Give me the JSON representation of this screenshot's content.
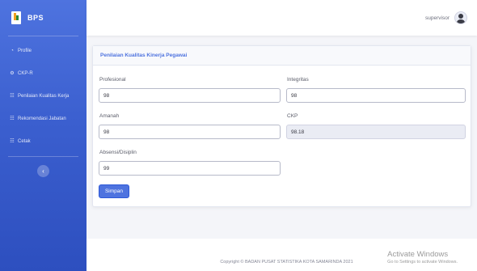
{
  "brand": {
    "name": "BPS",
    "logo_icon": "bps-logo-icon"
  },
  "sidebar": {
    "items": [
      {
        "label": "Profile",
        "icon": "gauge-icon"
      },
      {
        "label": "CKP-R",
        "icon": "gear-icon"
      },
      {
        "label": "Penilaian Kualitas Kerja",
        "icon": "users-icon"
      },
      {
        "label": "Rekomendasi Jabatan",
        "icon": "users-icon"
      },
      {
        "label": "Cetak",
        "icon": "users-icon"
      }
    ],
    "toggle_icon": "chevron-left-icon"
  },
  "topbar": {
    "user_name": "supervisor"
  },
  "card": {
    "title": "Penilaian Kualitas Kinerja Pegawai",
    "fields": {
      "profesional": {
        "label": "Profesional",
        "value": "98"
      },
      "integritas": {
        "label": "Integritas",
        "value": "98"
      },
      "amanah": {
        "label": "Amanah",
        "value": "98"
      },
      "ckp": {
        "label": "CKP",
        "value": "98.18"
      },
      "absensi": {
        "label": "Absensi/Disiplin",
        "value": "99"
      }
    },
    "save_label": "Simpan"
  },
  "footer": {
    "copyright": "Copyright © BADAN PUSAT STATISTIKA KOTA SAMARINDA 2021"
  },
  "watermark": {
    "title": "Activate Windows",
    "subtitle": "Go to Settings to activate Windows."
  },
  "colors": {
    "primary": "#4e73df",
    "sidebar_dark": "#2d4fbf",
    "background": "#f4f5f9"
  }
}
